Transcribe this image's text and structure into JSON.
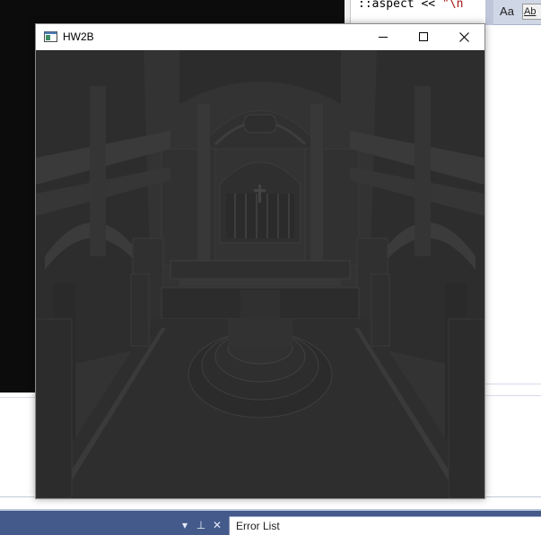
{
  "app_window": {
    "title": "HW2B",
    "icon": "console-app-icon",
    "buttons": {
      "minimize": "minimize-icon",
      "maximize": "maximize-icon",
      "close": "close-icon"
    }
  },
  "viewport": {
    "content": "3d-render-cathedral-interior",
    "background_color": "#333333"
  },
  "editor": {
    "code_fragment": "::aspect << ",
    "code_string": "\"\\n",
    "find_options": {
      "match_case": "Aa",
      "match_word": "Ab"
    }
  },
  "bottom_panel": {
    "tab_label": "Error List",
    "pane_buttons": [
      "window-position-icon",
      "pin-icon",
      "close-icon"
    ],
    "pane_glyphs": [
      "▾",
      "⊥",
      "✕"
    ]
  },
  "colors": {
    "console_bg": "#0c0c0c",
    "vs_toolbar": "#445a8a",
    "scene_base": "#333333"
  }
}
